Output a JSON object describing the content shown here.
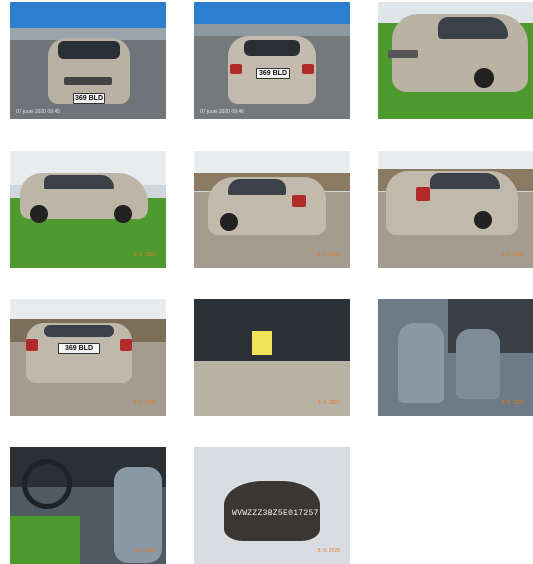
{
  "gallery": {
    "photos": [
      {
        "kind": "front-view-lot",
        "stamp": "07 juuni 2020 09:45",
        "plate": "369 BLD"
      },
      {
        "kind": "rear-view-lot",
        "stamp": "07 juuni 2020 09:46",
        "plate": "369 BLD"
      },
      {
        "kind": "front-three-quarter-grass"
      },
      {
        "kind": "side-view-grass",
        "date": "8. 8. 2020"
      },
      {
        "kind": "rear-three-quarter-left",
        "date": "8. 8. 2020"
      },
      {
        "kind": "rear-three-quarter-right",
        "date": "8. 8. 2020"
      },
      {
        "kind": "rear-view-fence",
        "plate": "369 BLD",
        "date": "8. 8. 2020"
      },
      {
        "kind": "windshield-note",
        "date": "8. 8. 2020"
      },
      {
        "kind": "interior-front-seats",
        "date": "8. 8. 2020"
      },
      {
        "kind": "interior-dashboard",
        "date": "8. 8. 2020"
      },
      {
        "kind": "vin-plate",
        "vin": "WVWZZZ3BZ5E017257",
        "date": "8. 8. 2020"
      }
    ]
  },
  "colors": {
    "car": "#bfb8a9",
    "sky": "#2f7fd0",
    "grass": "#4e9a2e",
    "asphalt": "#6f7478",
    "gravel": "#a49d8f",
    "interior": "#6e7a86",
    "date_stamp": "#e07a2a"
  }
}
